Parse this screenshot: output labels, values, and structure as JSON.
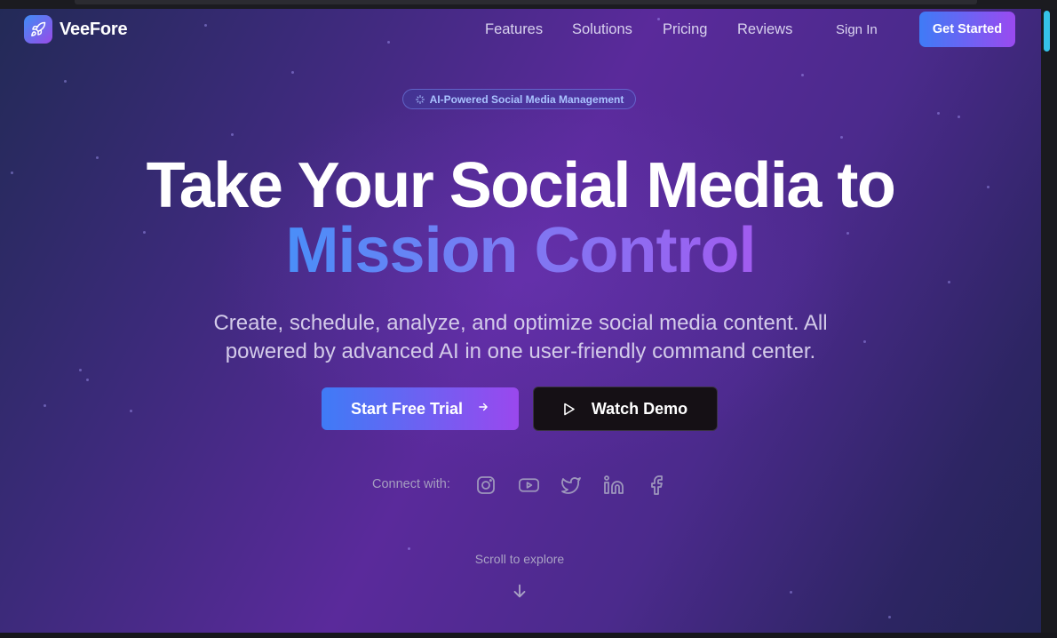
{
  "brand": {
    "name": "VeeFore",
    "icon": "rocket-icon"
  },
  "nav": {
    "links": [
      "Features",
      "Solutions",
      "Pricing",
      "Reviews"
    ],
    "sign_in": "Sign In",
    "cta": "Get Started"
  },
  "hero": {
    "badge": "AI-Powered Social Media Management",
    "badge_icon": "sparkle-icon",
    "headline_line1": "Take Your Social Media to",
    "headline_line2": "Mission Control",
    "subtitle_line1": "Create, schedule, analyze, and optimize social media content. All",
    "subtitle_line2": "powered by advanced AI in one user-friendly command center.",
    "primary_button": "Start Free Trial",
    "secondary_button": "Watch Demo"
  },
  "connect": {
    "label": "Connect with:",
    "icons": [
      "instagram-icon",
      "youtube-icon",
      "twitter-icon",
      "linkedin-icon",
      "facebook-icon"
    ]
  },
  "scroll": {
    "label": "Scroll to explore"
  },
  "colors": {
    "accent_start": "#3f7bf6",
    "accent_end": "#9a4af0",
    "scrollbar": "#35c2e8"
  }
}
